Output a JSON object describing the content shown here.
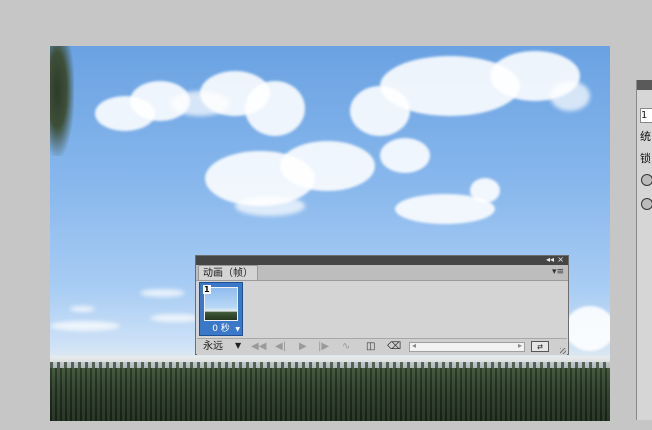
{
  "animation_panel": {
    "tab_label": "动画（帧）",
    "tab_close": "×",
    "collapse_icon": "◂◂",
    "close_icon": "×",
    "menu_icon": "▾≡",
    "frames": [
      {
        "number": "1",
        "delay": "0 秒"
      }
    ],
    "loop_option": "永远",
    "controls": {
      "first_frame": "◀◀",
      "prev_frame": "◀|",
      "play": "▶",
      "next_frame": "|▶",
      "tween": "∿",
      "new_frame": "◫",
      "delete": "⌫"
    }
  },
  "side_panel": {
    "input_value": "1",
    "label_1": "统",
    "label_2": "锁"
  }
}
